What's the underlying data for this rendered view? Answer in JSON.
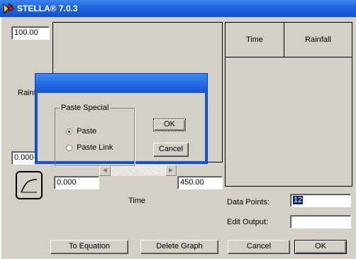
{
  "window": {
    "title": "STELLA® 7.0.3"
  },
  "graph": {
    "y_max": "100.00",
    "y_min": "0.000",
    "y_label": "Rainf",
    "x_min": "0.000",
    "x_max": "450.00",
    "x_label": "Time"
  },
  "table": {
    "col_time": "Time",
    "col_rainfall": "Rainfall"
  },
  "data_points": {
    "label": "Data Points:",
    "value": "12"
  },
  "edit_output": {
    "label": "Edit Output:",
    "value": ""
  },
  "buttons": {
    "to_equation": "To Equation",
    "delete_graph": "Delete Graph",
    "cancel": "Cancel",
    "ok": "OK"
  },
  "dialog": {
    "group_title": "Paste Special",
    "option_paste": "Paste",
    "option_paste_link": "Paste Link",
    "ok": "OK",
    "cancel": "Cancel"
  }
}
